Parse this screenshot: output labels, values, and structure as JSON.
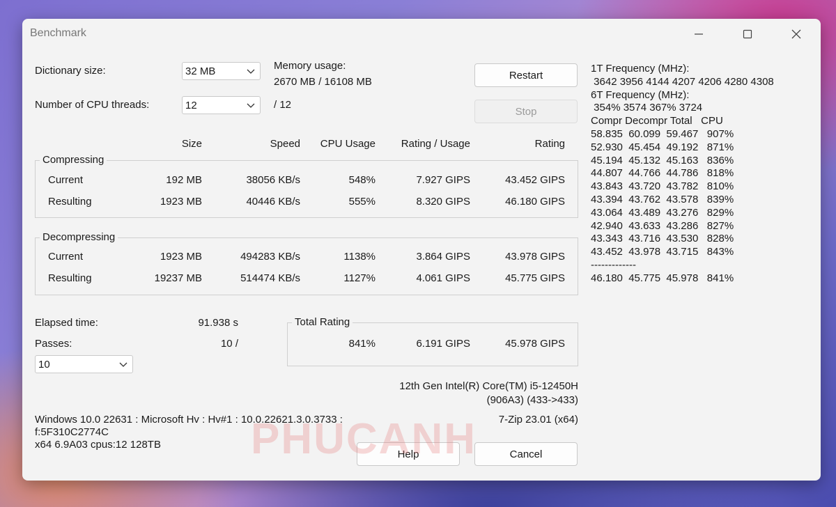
{
  "window": {
    "title": "Benchmark"
  },
  "controls": {
    "dict_label": "Dictionary size:",
    "dict_value": "32 MB",
    "threads_label": "Number of CPU threads:",
    "threads_value": "12",
    "threads_suffix": "/ 12",
    "memory_label": "Memory usage:",
    "memory_value": "2670 MB / 16108 MB",
    "restart": "Restart",
    "stop": "Stop"
  },
  "columns": {
    "size": "Size",
    "speed": "Speed",
    "cpu": "CPU Usage",
    "rpu": "Rating / Usage",
    "rating": "Rating"
  },
  "compressing": {
    "label": "Compressing",
    "current": {
      "label": "Current",
      "size": "192 MB",
      "speed": "38056 KB/s",
      "cpu": "548%",
      "rpu": "7.927 GIPS",
      "rating": "43.452 GIPS"
    },
    "resulting": {
      "label": "Resulting",
      "size": "1923 MB",
      "speed": "40446 KB/s",
      "cpu": "555%",
      "rpu": "8.320 GIPS",
      "rating": "46.180 GIPS"
    }
  },
  "decompressing": {
    "label": "Decompressing",
    "current": {
      "label": "Current",
      "size": "1923 MB",
      "speed": "494283 KB/s",
      "cpu": "1138%",
      "rpu": "3.864 GIPS",
      "rating": "43.978 GIPS"
    },
    "resulting": {
      "label": "Resulting",
      "size": "19237 MB",
      "speed": "514474 KB/s",
      "cpu": "1127%",
      "rpu": "4.061 GIPS",
      "rating": "45.775 GIPS"
    }
  },
  "elapsed": {
    "label": "Elapsed time:",
    "value": "91.938 s"
  },
  "passes": {
    "label": "Passes:",
    "value": "10 /",
    "select": "10"
  },
  "total": {
    "label": "Total Rating",
    "cpu": "841%",
    "rpu": "6.191 GIPS",
    "rating": "45.978 GIPS"
  },
  "cpu_info": {
    "line1": "12th Gen Intel(R) Core(TM) i5-12450H",
    "line2": "(906A3) (433->433)"
  },
  "version": "7-Zip 23.01 (x64)",
  "sysinfo": {
    "line1": "Windows 10.0 22631 : Microsoft Hv : Hv#1 : 10.0.22621.3.0.3733 :",
    "line2": "f:5F310C2774C",
    "line3": "x64 6.9A03 cpus:12 128TB"
  },
  "buttons": {
    "help": "Help",
    "cancel": "Cancel"
  },
  "log": {
    "lines": [
      "1T Frequency (MHz):",
      " 3642 3956 4144 4207 4206 4280 4308",
      "6T Frequency (MHz):",
      " 354% 3574 367% 3724",
      "Compr Decompr Total   CPU",
      "58.835  60.099  59.467   907%",
      "52.930  45.454  49.192   871%",
      "45.194  45.132  45.163   836%",
      "44.807  44.766  44.786   818%",
      "43.843  43.720  43.782   810%",
      "43.394  43.762  43.578   839%",
      "43.064  43.489  43.276   829%",
      "42.940  43.633  43.286   827%",
      "43.343  43.716  43.530   828%",
      "43.452  43.978  43.715   843%",
      "-------------",
      "46.180  45.775  45.978   841%"
    ]
  },
  "watermark": "PHUCANH"
}
